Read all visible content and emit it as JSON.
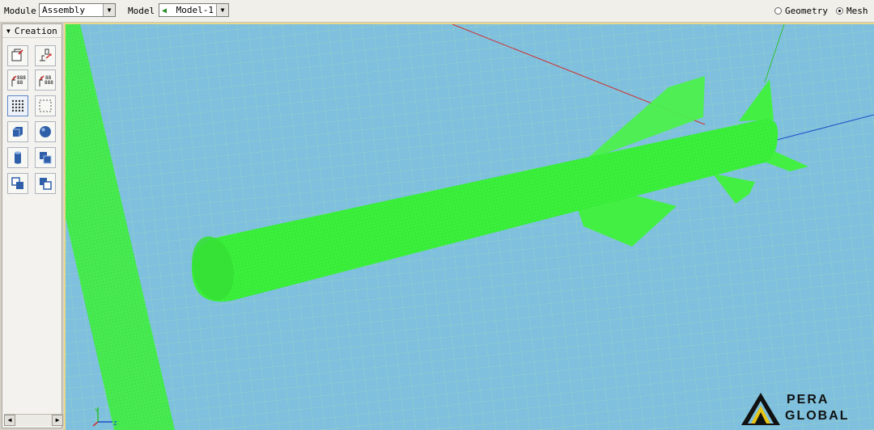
{
  "topbar": {
    "module_label": "Module",
    "module_value": "Assembly",
    "model_label": "Model",
    "model_value": "Model-1",
    "radio_geometry": "Geometry",
    "radio_mesh": "Mesh",
    "selected_view": "Mesh"
  },
  "toolbox": {
    "header": "Creation",
    "tools": [
      {
        "name": "create-instance-icon"
      },
      {
        "name": "translate-instance-icon"
      },
      {
        "name": "linear-pattern-icon"
      },
      {
        "name": "radial-pattern-icon"
      },
      {
        "name": "seed-grid-icon"
      },
      {
        "name": "seed-edge-icon"
      },
      {
        "name": "mesh-part-cube-icon"
      },
      {
        "name": "sphere-icon"
      },
      {
        "name": "cylinder-icon"
      },
      {
        "name": "merge-cube-icon"
      },
      {
        "name": "copy-instance-icon"
      },
      {
        "name": "boolean-instance-icon"
      }
    ]
  },
  "viewport": {
    "background_color": "#7ec0de",
    "mesh_color": "#3cff3c",
    "grid_color": "#aee6a6"
  },
  "logo": {
    "line1": "PERA",
    "line2": "GLOBAL"
  }
}
